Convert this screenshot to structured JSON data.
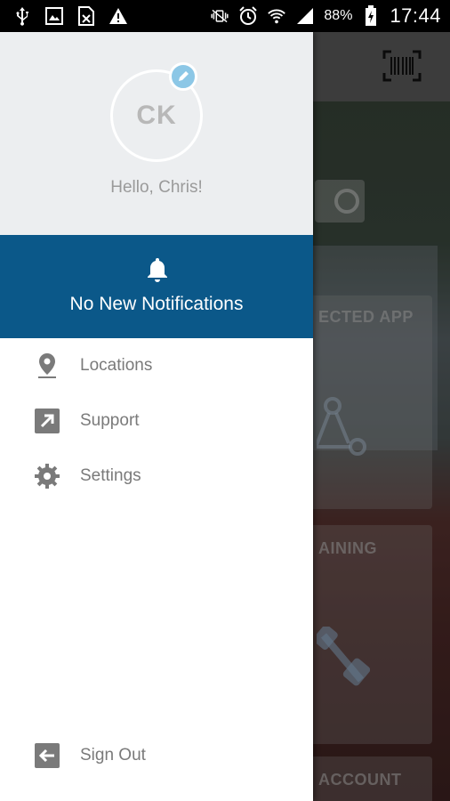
{
  "status_bar": {
    "icons_left": [
      "usb-icon",
      "image-icon",
      "sim-card-icon",
      "warning-icon"
    ],
    "icons_right": [
      "vibrate-mute-icon",
      "alarm-icon",
      "wifi-icon",
      "signal-icon"
    ],
    "battery_percent": "88%",
    "time": "17:44"
  },
  "background": {
    "card_labels": [
      "ECTED APP",
      "AINING",
      "ACCOUNT"
    ]
  },
  "drawer": {
    "avatar_initials": "CK",
    "greeting": "Hello, Chris!",
    "notifications_text": "No New Notifications",
    "menu": {
      "locations": "Locations",
      "support": "Support",
      "settings": "Settings"
    },
    "sign_out": "Sign Out"
  },
  "colors": {
    "notification_bar": "#0b5889",
    "profile_bg": "#eceef0",
    "edit_badge": "#8cc7e6",
    "menu_icon": "#7a7a7a"
  }
}
